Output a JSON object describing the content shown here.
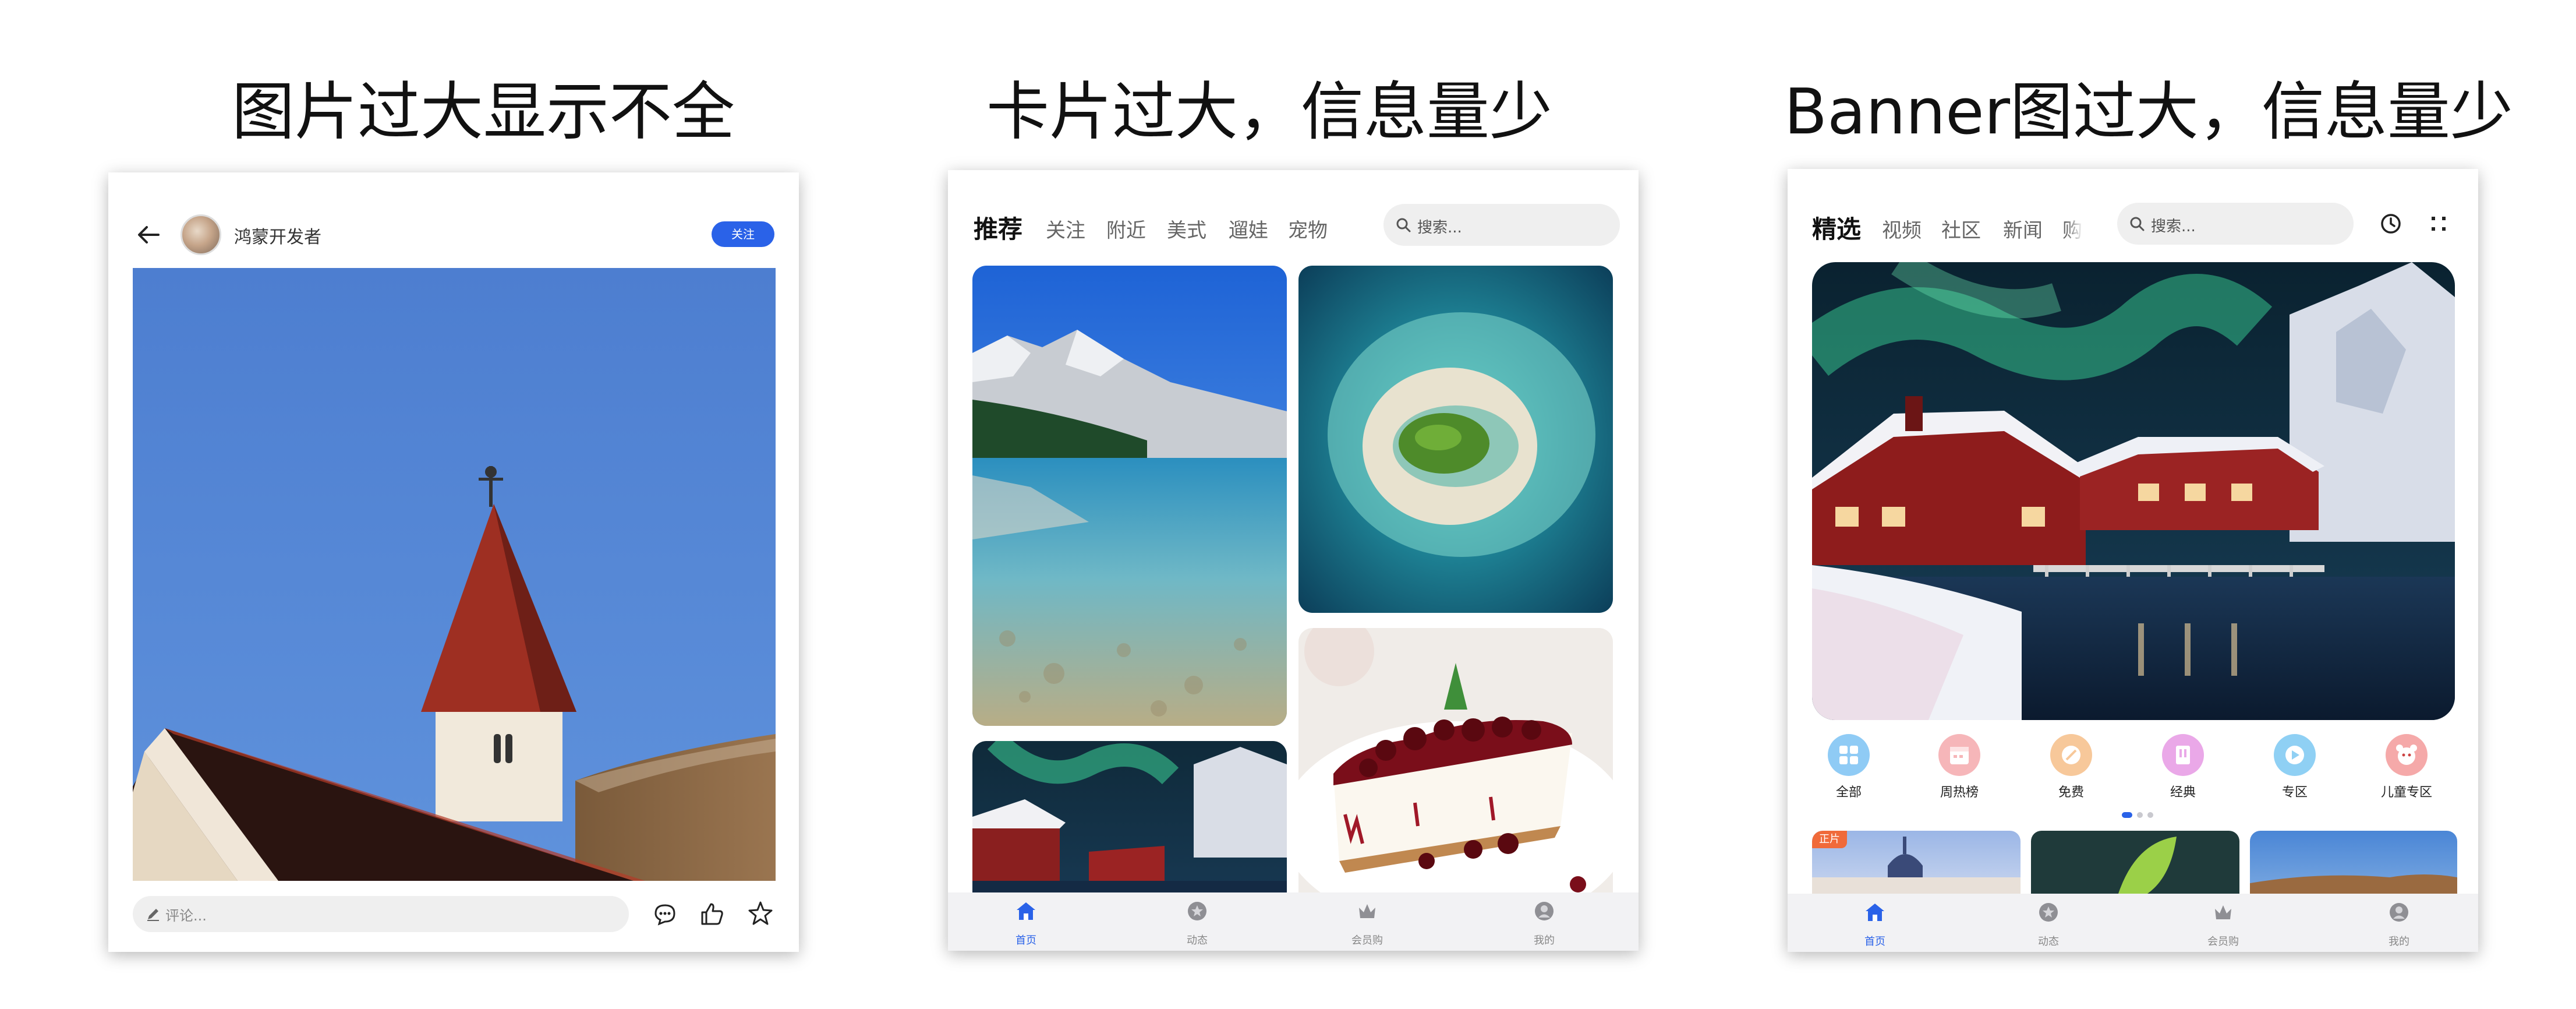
{
  "captions": {
    "left": "图片过大显示不全",
    "middle": "卡片过大，信息量少",
    "right": "Banner图过大，信息量少"
  },
  "post_panel": {
    "author": "鸿蒙开发者",
    "follow_label": "关注",
    "comment_placeholder": "评论...",
    "icons": [
      "back-arrow-icon",
      "avatar",
      "edit-icon",
      "comment-icon",
      "like-icon",
      "star-icon"
    ]
  },
  "feed_panel": {
    "tabs": [
      {
        "label": "推荐",
        "active": true
      },
      {
        "label": "关注",
        "active": false
      },
      {
        "label": "附近",
        "active": false
      },
      {
        "label": "美式",
        "active": false
      },
      {
        "label": "遛娃",
        "active": false
      },
      {
        "label": "宠物",
        "active": false
      }
    ],
    "search_placeholder": "搜索...",
    "nav": [
      {
        "label": "首页",
        "icon": "home-icon",
        "active": true
      },
      {
        "label": "动态",
        "icon": "activity-icon",
        "active": false
      },
      {
        "label": "会员购",
        "icon": "crown-icon",
        "active": false
      },
      {
        "label": "我的",
        "icon": "user-icon",
        "active": false
      }
    ]
  },
  "banner_panel": {
    "tabs": [
      {
        "label": "精选",
        "active": true
      },
      {
        "label": "视频",
        "active": false
      },
      {
        "label": "社区",
        "active": false
      },
      {
        "label": "新闻",
        "active": false
      },
      {
        "label": "购",
        "active": false
      }
    ],
    "search_placeholder": "搜索...",
    "categories": [
      {
        "label": "全部",
        "color": "#8fcbf5"
      },
      {
        "label": "周热榜",
        "color": "#f6b6b9"
      },
      {
        "label": "免费",
        "color": "#f7c89a"
      },
      {
        "label": "经典",
        "color": "#eaa8e8"
      },
      {
        "label": "专区",
        "color": "#8fd0f4"
      },
      {
        "label": "儿童专区",
        "color": "#f5a9a9"
      }
    ],
    "badge": "正片",
    "nav": [
      {
        "label": "首页",
        "icon": "home-icon",
        "active": true
      },
      {
        "label": "动态",
        "icon": "activity-icon",
        "active": false
      },
      {
        "label": "会员购",
        "icon": "crown-icon",
        "active": false
      },
      {
        "label": "我的",
        "icon": "user-icon",
        "active": false
      }
    ]
  },
  "colors": {
    "accent": "#2a62e8",
    "sky": "#4d7fce",
    "nav_bg": "#f2f2f4"
  }
}
